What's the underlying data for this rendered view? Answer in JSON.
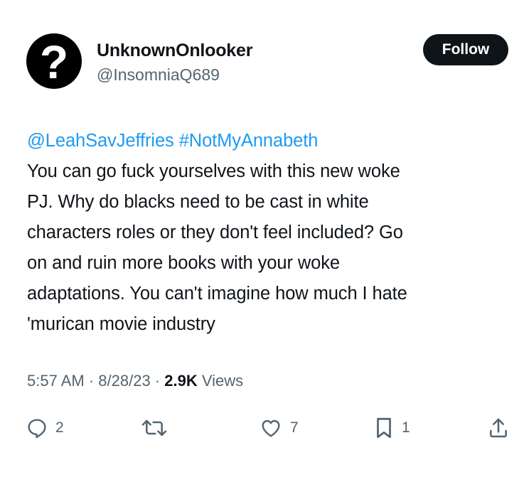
{
  "author": {
    "display_name": "UnknownOnlooker",
    "handle": "@InsomniaQ689",
    "avatar_glyph": "?"
  },
  "follow_label": "Follow",
  "tweet": {
    "mentions": [
      "@LeahSavJeffries",
      "#NotMyAnnabeth"
    ],
    "lines": [
      "You can go fuck yourselves with this new woke",
      "PJ. Why do blacks need to be cast in white",
      "characters roles or they don't feel included? Go",
      "on and ruin more books with your woke",
      "adaptations. You can't imagine how much I hate",
      "'murican movie industry"
    ]
  },
  "meta": {
    "time": "5:57 AM",
    "sep1": " · ",
    "date": "8/28/23",
    "sep2": " · ",
    "views_count": "2.9K",
    "views_label": " Views"
  },
  "actions": {
    "reply": {
      "icon": "reply-icon",
      "count": "2"
    },
    "retweet": {
      "icon": "retweet-icon",
      "count": ""
    },
    "like": {
      "icon": "heart-icon",
      "count": "7"
    },
    "bookmark": {
      "icon": "bookmark-icon",
      "count": "1"
    },
    "share": {
      "icon": "share-icon"
    }
  },
  "colors": {
    "text": "#0f1419",
    "secondary": "#536471",
    "link": "#1d9bf0",
    "button_bg": "#0f1419"
  }
}
